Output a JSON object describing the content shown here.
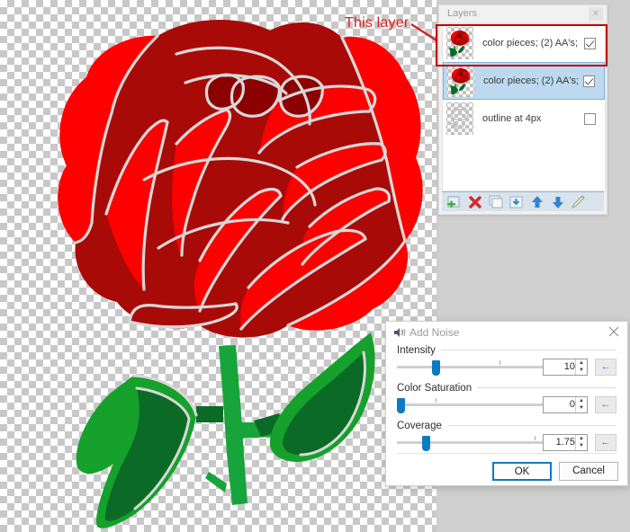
{
  "annotation": {
    "text": "This layer",
    "color": "#d81f1f",
    "arrow_icon": "arrow-pointing-right-down"
  },
  "canvas": {
    "name": "image-canvas",
    "transparency_checkerboard": true,
    "artwork": "red-rose-with-green-stem-and-leaves",
    "colors": {
      "rose_bright": "#FF0000",
      "rose_dark": "#A80A08",
      "rose_darkest": "#8B0000",
      "leaf_light": "#16A02C",
      "leaf_dark": "#0B6B26",
      "stem": "#17A43A",
      "outline": "#D8D8D8"
    }
  },
  "layers_panel": {
    "title": "Layers",
    "close_icon": "close-icon",
    "items": [
      {
        "label": "color pieces; (2) AA's;",
        "visible": true,
        "selected": false,
        "highlighted": true,
        "thumb": "rose-thumbnail"
      },
      {
        "label": "color pieces; (2) AA's;",
        "visible": true,
        "selected": true,
        "highlighted": false,
        "thumb": "rose-thumbnail"
      },
      {
        "label": "outline at 4px",
        "visible": false,
        "selected": false,
        "highlighted": false,
        "thumb": "outline-thumbnail"
      }
    ],
    "toolbar": [
      {
        "name": "add-layer-icon",
        "tip": "Add New Layer"
      },
      {
        "name": "delete-layer-icon",
        "tip": "Delete Layer"
      },
      {
        "name": "duplicate-layer-icon",
        "tip": "Duplicate Layer"
      },
      {
        "name": "merge-layer-down-icon",
        "tip": "Merge Layer Down"
      },
      {
        "name": "move-layer-up-icon",
        "tip": "Move Layer Up"
      },
      {
        "name": "move-layer-down-icon",
        "tip": "Move Layer Down"
      },
      {
        "name": "layer-properties-icon",
        "tip": "Layer Properties"
      }
    ],
    "highlight_color": "#bf0000"
  },
  "noise_dialog": {
    "title": "Add Noise",
    "title_icon": "add-noise-icon",
    "close_icon": "close-icon",
    "fields": [
      {
        "label": "Intensity",
        "value": "10",
        "slider_percent": 22,
        "tick_percent": 64
      },
      {
        "label": "Color Saturation",
        "value": "0",
        "slider_percent": 1,
        "tick_percent": 24
      },
      {
        "label": "Coverage",
        "value": "1.75",
        "slider_percent": 16,
        "tick_percent": 86
      }
    ],
    "reset_icon": "reset-arrow-icon",
    "spinner_up": "▲",
    "spinner_down": "▼",
    "ok_label": "OK",
    "cancel_label": "Cancel",
    "accent_color": "#0d7ac4"
  }
}
